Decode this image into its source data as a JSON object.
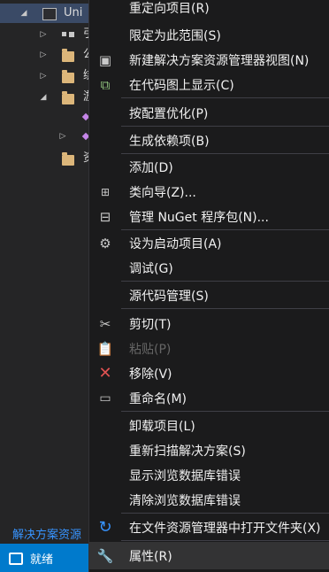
{
  "tree": {
    "project_label": "Uni",
    "rows": [
      {
        "label": "引",
        "kind": "ref"
      },
      {
        "label": "公",
        "kind": "folder"
      },
      {
        "label": "绑",
        "kind": "folder"
      },
      {
        "label": "游",
        "kind": "folder"
      },
      {
        "label": "",
        "kind": "item"
      },
      {
        "label": "",
        "kind": "item"
      },
      {
        "label": "资",
        "kind": "folder"
      }
    ],
    "footer_link": "解决方案资源"
  },
  "status": {
    "text": "就绪"
  },
  "menu": {
    "items": {
      "retarget": "重定向项目(R)",
      "scope": "限定为此范围(S)",
      "new_view": "新建解决方案资源管理器视图(N)",
      "code_map": "在代码图上显示(C)",
      "optimize": "按配置优化(P)",
      "build_deps": "生成依赖项(B)",
      "add": "添加(D)",
      "class_wizard": "类向导(Z)...",
      "nuget": "管理 NuGet 程序包(N)...",
      "startup": "设为启动项目(A)",
      "debug": "调试(G)",
      "source_control": "源代码管理(S)",
      "cut": "剪切(T)",
      "paste": "粘贴(P)",
      "remove": "移除(V)",
      "rename": "重命名(M)",
      "unload": "卸载项目(L)",
      "rescan": "重新扫描解决方案(S)",
      "show_db_errors": "显示浏览数据库错误",
      "clear_db_errors": "清除浏览数据库错误",
      "open_folder": "在文件资源管理器中打开文件夹(X)",
      "properties": "属性(R)"
    }
  }
}
